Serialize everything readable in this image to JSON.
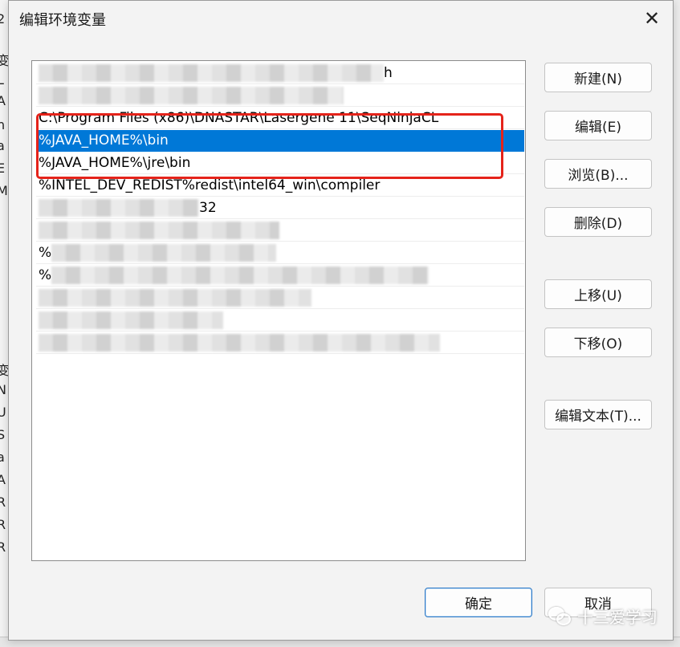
{
  "background_window": {
    "chars": [
      "2",
      "变",
      "L",
      "A",
      "n",
      "a",
      "E",
      "M",
      "变",
      "N",
      "U",
      "S",
      "a",
      "A",
      "R",
      "R",
      "R"
    ]
  },
  "dialog": {
    "title": "编辑环境变量",
    "close_glyph": "✕"
  },
  "list": {
    "items": [
      {
        "text": "h",
        "blurred": true,
        "selected": false
      },
      {
        "text": "",
        "blurred": true,
        "selected": false
      },
      {
        "text": "C:\\Program Files (x86)\\DNASTAR\\Lasergene 11\\SeqNinjaCL",
        "blurred": false,
        "selected": false
      },
      {
        "text": "%JAVA_HOME%\\bin",
        "blurred": false,
        "selected": true
      },
      {
        "text": "%JAVA_HOME%\\jre\\bin",
        "blurred": false,
        "selected": false
      },
      {
        "text": "%INTEL_DEV_REDIST%redist\\intel64_win\\compiler",
        "blurred": false,
        "selected": false
      },
      {
        "text": "32",
        "blurred": true,
        "selected": false
      },
      {
        "text": "",
        "blurred": true,
        "selected": false
      },
      {
        "text": "%",
        "blurred": true,
        "selected": false
      },
      {
        "text": "%",
        "blurred": true,
        "selected": false
      },
      {
        "text": "",
        "blurred": true,
        "selected": false
      },
      {
        "text": "",
        "blurred": true,
        "selected": false
      },
      {
        "text": "",
        "blurred": true,
        "selected": false
      }
    ]
  },
  "buttons": {
    "new": "新建(N)",
    "edit": "编辑(E)",
    "browse": "浏览(B)...",
    "delete": "删除(D)",
    "move_up": "上移(U)",
    "move_down": "下移(O)",
    "edit_text": "编辑文本(T)...",
    "ok": "确定",
    "cancel": "取消"
  },
  "watermark": {
    "text": "十三爱学习"
  },
  "colors": {
    "selection": "#0078d7",
    "highlight_box": "#e5231a"
  }
}
